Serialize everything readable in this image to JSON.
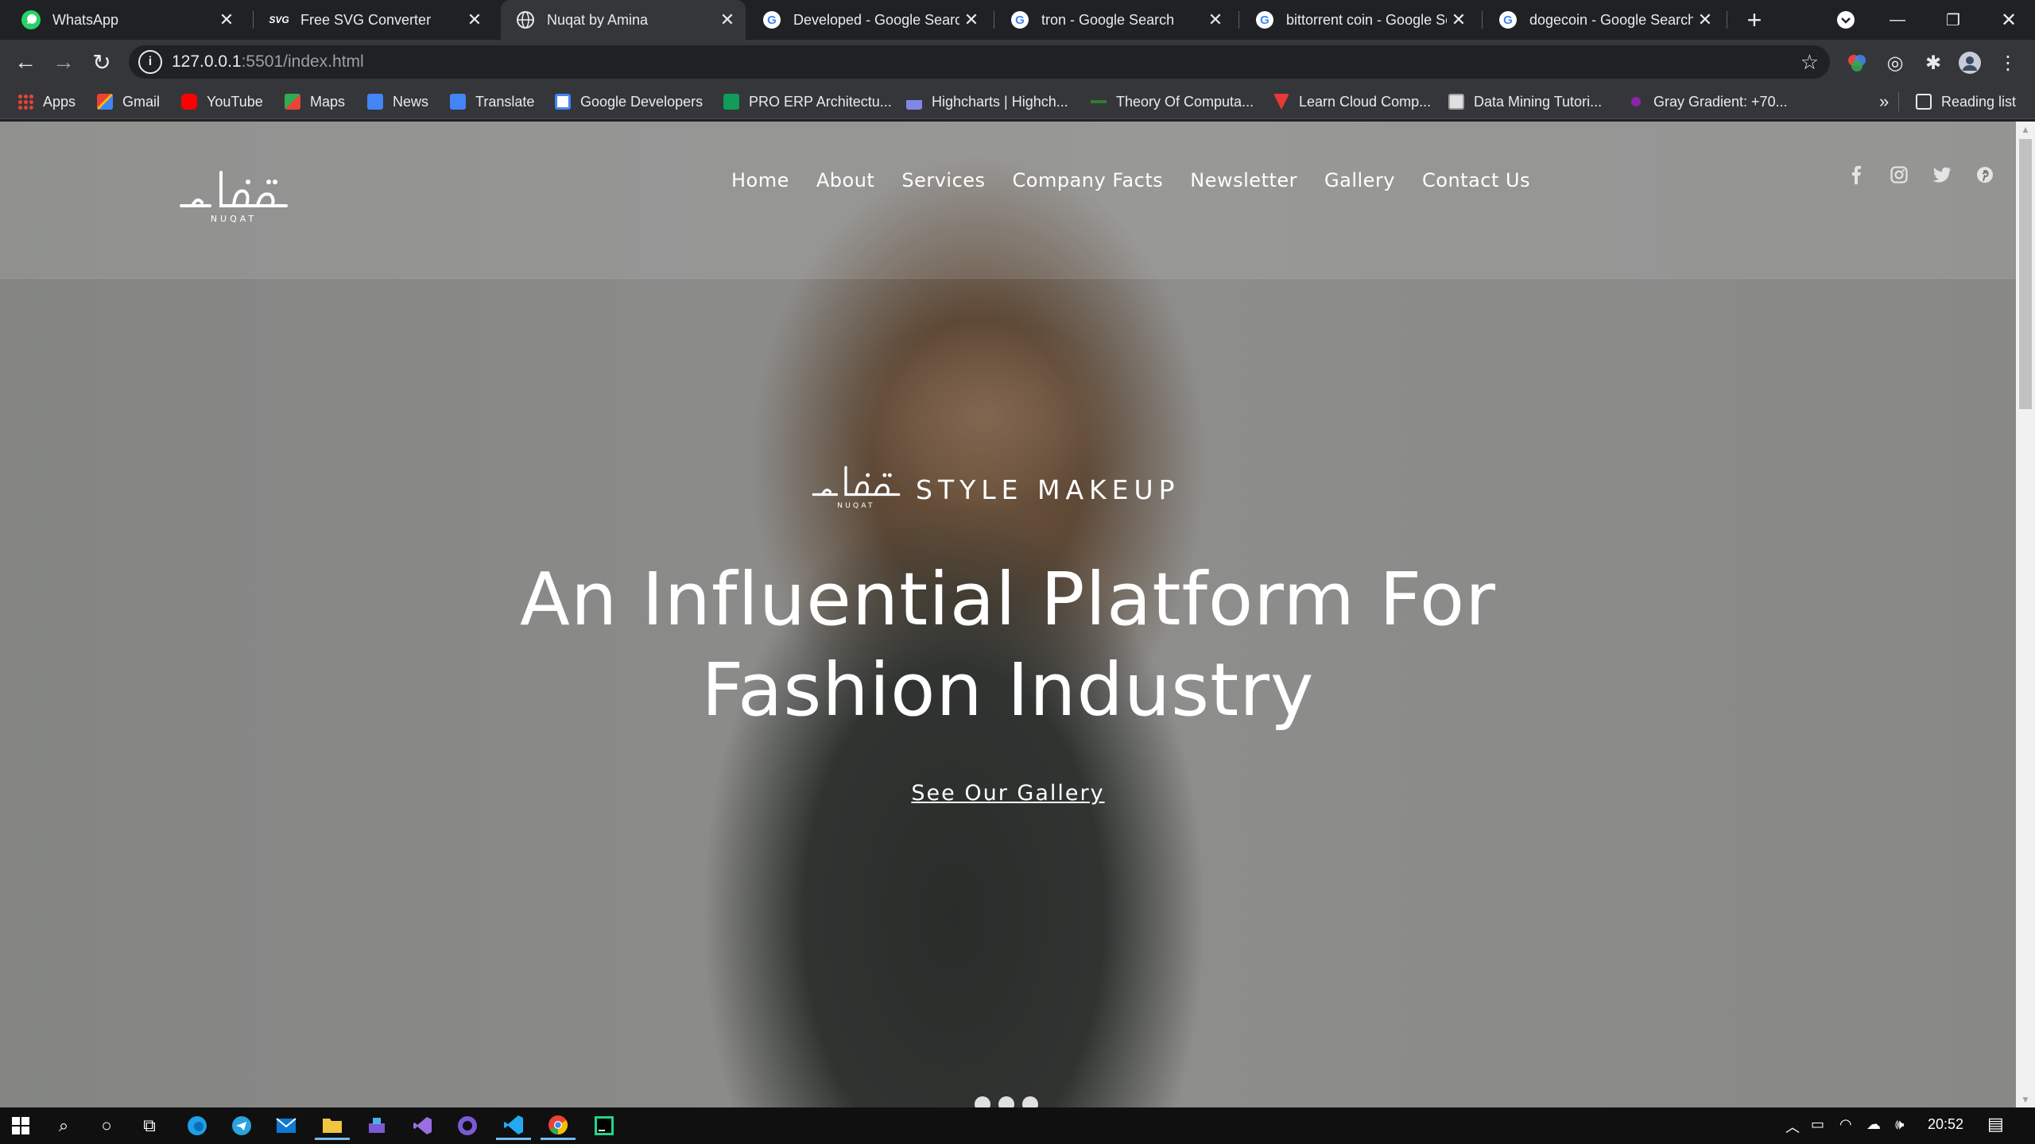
{
  "browser": {
    "tabs": [
      {
        "title": "WhatsApp",
        "icon": "whatsapp-icon"
      },
      {
        "title": "Free SVG Converter",
        "icon": "svg-icon"
      },
      {
        "title": "Nuqat by Amina",
        "icon": "globe-icon"
      },
      {
        "title": "Developed - Google Search",
        "icon": "google-icon"
      },
      {
        "title": "tron - Google Search",
        "icon": "google-icon"
      },
      {
        "title": "bittorrent coin - Google Search",
        "icon": "google-icon"
      },
      {
        "title": "dogecoin - Google Search",
        "icon": "google-icon"
      }
    ],
    "active_tab_index": 2,
    "url_host": "127.0.0.1",
    "url_rest": ":5501/index.html",
    "bookmarks": [
      {
        "label": "Apps",
        "icon": "apps-grid-icon",
        "color": "#ea4335"
      },
      {
        "label": "Gmail",
        "icon": "gmail-icon",
        "color": "#ea4335"
      },
      {
        "label": "YouTube",
        "icon": "youtube-icon",
        "color": "#ff0000"
      },
      {
        "label": "Maps",
        "icon": "maps-icon",
        "color": "#34a853"
      },
      {
        "label": "News",
        "icon": "news-icon",
        "color": "#4285f4"
      },
      {
        "label": "Translate",
        "icon": "translate-icon",
        "color": "#4285f4"
      },
      {
        "label": "Google Developers",
        "icon": "google-developers-icon",
        "color": "#4285f4"
      },
      {
        "label": "PRO ERP Architectu...",
        "icon": "erp-icon",
        "color": "#0f9d58"
      },
      {
        "label": "Highcharts | Highch...",
        "icon": "highcharts-icon",
        "color": "#8087e8"
      },
      {
        "label": "Theory Of Computa...",
        "icon": "toc-icon",
        "color": "#2e7d32"
      },
      {
        "label": "Learn Cloud Comp...",
        "icon": "cloud-icon",
        "color": "#e53935"
      },
      {
        "label": "Data Mining Tutori...",
        "icon": "data-mining-icon",
        "color": "#9e9e9e"
      },
      {
        "label": "Gray Gradient: +70...",
        "icon": "gradient-icon",
        "color": "#8e24aa"
      }
    ],
    "bookmarks_overflow": "»",
    "reading_list": "Reading list"
  },
  "site": {
    "nav": [
      "Home",
      "About",
      "Services",
      "Company Facts",
      "Newsletter",
      "Gallery",
      "Contact Us"
    ],
    "social": [
      "facebook-icon",
      "instagram-icon",
      "twitter-icon",
      "pinterest-icon"
    ],
    "logo_text": "NUQAT",
    "brand_tag": "STYLE MAKEUP",
    "headline_line1": "An Influential Platform For",
    "headline_line2": "Fashion Industry",
    "cta": "See Our Gallery",
    "slides": 3
  },
  "taskbar": {
    "apps": [
      "windows-start-icon",
      "search-icon",
      "cortana-icon",
      "task-view-icon",
      "edge-icon",
      "telegram-icon",
      "mail-icon",
      "file-explorer-icon",
      "tool-icon",
      "visual-studio-icon",
      "github-icon",
      "vscode-icon",
      "chrome-icon",
      "pycharm-icon"
    ],
    "time": "20:52"
  },
  "colors": {
    "chrome_dark": "#202124",
    "chrome_toolbar": "#35363a",
    "text_light": "#e8eaed",
    "hero_text": "#ffffff"
  }
}
